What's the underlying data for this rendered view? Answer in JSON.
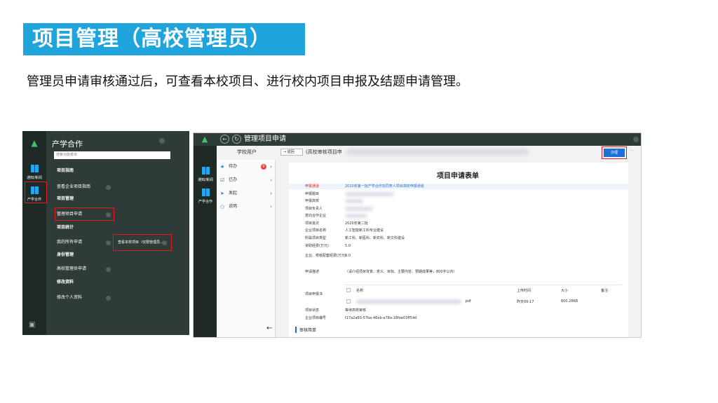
{
  "slide": {
    "title": "项目管理（高校管理员）",
    "description": "管理员申请审核通过后，可查看本校项目、进行校内项目申报及结题申请管理。"
  },
  "left_shot": {
    "rail": [
      {
        "label": "通知/新闻",
        "icon": "windows-tile-icon"
      },
      {
        "label": "产学合作",
        "icon": "windows-tile-icon"
      }
    ],
    "header": "产学合作",
    "search_placeholder": "搜索功能菜单",
    "menu": [
      {
        "label": "项目指南",
        "bold": true
      },
      {
        "label": "查看企业项目指南",
        "bold": false
      },
      {
        "label": "项目管理",
        "bold": true
      },
      {
        "label": "管理项目申请",
        "bold": false
      },
      {
        "label": "项目统计",
        "bold": true
      },
      {
        "label": "我的所有申请",
        "bold": false
      },
      {
        "label": "身份管理",
        "bold": true
      },
      {
        "label": "高校管理员申请",
        "bold": false
      },
      {
        "label": "修改资料",
        "bold": true
      },
      {
        "label": "修改个人资料",
        "bold": false
      }
    ],
    "popup": "查看本校项目（仅限管理员...",
    "colors": {
      "panel": "#2f3b38",
      "rail": "#1f2a27",
      "highlight": "#e21d1d"
    }
  },
  "right_shot": {
    "window_title": "管理项目申请",
    "user_label": "学校用户",
    "back_button": "返回",
    "breadcrumb": "(高校审核项目申",
    "action_button": "办理",
    "more": "···",
    "rail": [
      {
        "label": "通知/新闻"
      },
      {
        "label": "产学合作"
      }
    ],
    "side_menu": [
      {
        "label": "待办",
        "icon": "thumbs-up-icon",
        "badge": "0"
      },
      {
        "label": "已办",
        "icon": "check-icon",
        "badge": ""
      },
      {
        "label": "发起",
        "icon": "send-icon",
        "badge": ""
      },
      {
        "label": "说明",
        "icon": "info-icon",
        "badge": ""
      }
    ],
    "form_title": "项目申请表单",
    "fields": [
      {
        "key": "申报通道",
        "value": "2020年第一批产学合作协同育人项目高校申报通道"
      },
      {
        "key": "申报题目",
        "value": ""
      },
      {
        "key": "申报高校",
        "value": ""
      },
      {
        "key": "项目负责人",
        "value": ""
      },
      {
        "key": "意向合作企业",
        "value": ""
      },
      {
        "key": "项目批次",
        "value": "2020年第二批"
      },
      {
        "key": "企业项目名称",
        "value": "人工智能新工科专业建设"
      },
      {
        "key": "所属项目类型",
        "value": "新工科、新医科、新农科、新文科建设"
      },
      {
        "key": "资助经费(万元)",
        "value": "5.0"
      },
      {
        "key": "企业、校级配套经费(万元)",
        "value": "0.0"
      },
      {
        "key": "申请描述",
        "value": "（请介绍项目背景、意义、目标、主要内容、预期成果等，800字以内）"
      },
      {
        "key": "项目申报书",
        "value": ""
      },
      {
        "key": "项目状态",
        "value": "等待高校审核"
      },
      {
        "key": "企业项目编号",
        "value": "f17a2a60-57ba-46eb-a78a-18fee03ff54d"
      }
    ],
    "attachments": {
      "headers": [
        "名称",
        "上传时间",
        "大小",
        "备注"
      ],
      "rows": [
        {
          "name_suffix": ".pdf",
          "time": "昨天09:17",
          "size": "600.28KB",
          "note": ""
        }
      ]
    },
    "review_section": "审核简单",
    "back_arrow": "←",
    "colors": {
      "accent": "#1f6fd8",
      "highlight": "#e21d1d",
      "topbar": "#2f3b38"
    }
  }
}
